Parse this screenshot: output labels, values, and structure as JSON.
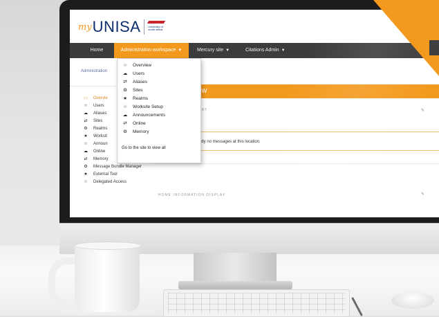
{
  "brand": {
    "logo_prefix": "my",
    "logo_name": "UNISA",
    "crest_text": "university of south africa",
    "accent_color": "#f39a1e",
    "navbar_color": "#3b3c3e"
  },
  "navbar": {
    "home": "Home",
    "admin_workspace": "Administration workspace",
    "mercury": "Mercury site",
    "citations": "Citations Admin"
  },
  "breadcrumb": "Administration",
  "dropdown": {
    "items": [
      {
        "icon": "star-outline-icon",
        "glyph": "☆",
        "label": "Overview"
      },
      {
        "icon": "users-icon",
        "glyph": "☁",
        "label": "Users"
      },
      {
        "icon": "aliases-icon",
        "glyph": "⇄",
        "label": "Aliases"
      },
      {
        "icon": "sites-icon",
        "glyph": "⚙",
        "label": "Sites"
      },
      {
        "icon": "realms-icon",
        "glyph": "★",
        "label": "Realms"
      },
      {
        "icon": "worksite-setup-icon",
        "glyph": "☆",
        "label": "Worksite Setup"
      },
      {
        "icon": "announcements-icon",
        "glyph": "☁",
        "label": "Announcements"
      },
      {
        "icon": "online-icon",
        "glyph": "⇄",
        "label": "Online"
      },
      {
        "icon": "memory-icon",
        "glyph": "⚙",
        "label": "Memory"
      }
    ],
    "footer": "Go to the site to view all"
  },
  "sidebar": {
    "items": [
      {
        "icon": "overview-icon",
        "glyph": "▭",
        "label": "Overvie"
      },
      {
        "icon": "users-icon",
        "glyph": "☆",
        "label": "Users"
      },
      {
        "icon": "aliases-icon",
        "glyph": "☁",
        "label": "Aliases"
      },
      {
        "icon": "sites-icon",
        "glyph": "⇄",
        "label": "Sites"
      },
      {
        "icon": "realms-icon",
        "glyph": "⚙",
        "label": "Realms"
      },
      {
        "icon": "worksite-icon",
        "glyph": "★",
        "label": "Worksit"
      },
      {
        "icon": "announcements-icon",
        "glyph": "☆",
        "label": "Announ"
      },
      {
        "icon": "online-icon",
        "glyph": "☁",
        "label": "Online"
      },
      {
        "icon": "memory-icon",
        "glyph": "⇄",
        "label": "Memory"
      },
      {
        "icon": "message-bundle-icon",
        "glyph": "⚙",
        "label": "Message Bundle Manager"
      },
      {
        "icon": "external-tool-icon",
        "glyph": "★",
        "label": "External Tool"
      },
      {
        "icon": "delegated-access-icon",
        "glyph": "☆",
        "label": "Delegated Access"
      }
    ]
  },
  "main": {
    "title_fragment": "iew",
    "section1_fragment": "DAY",
    "message": "ently no messages at this location.",
    "section2_label": "HOME INFORMATION DISPLAY"
  }
}
